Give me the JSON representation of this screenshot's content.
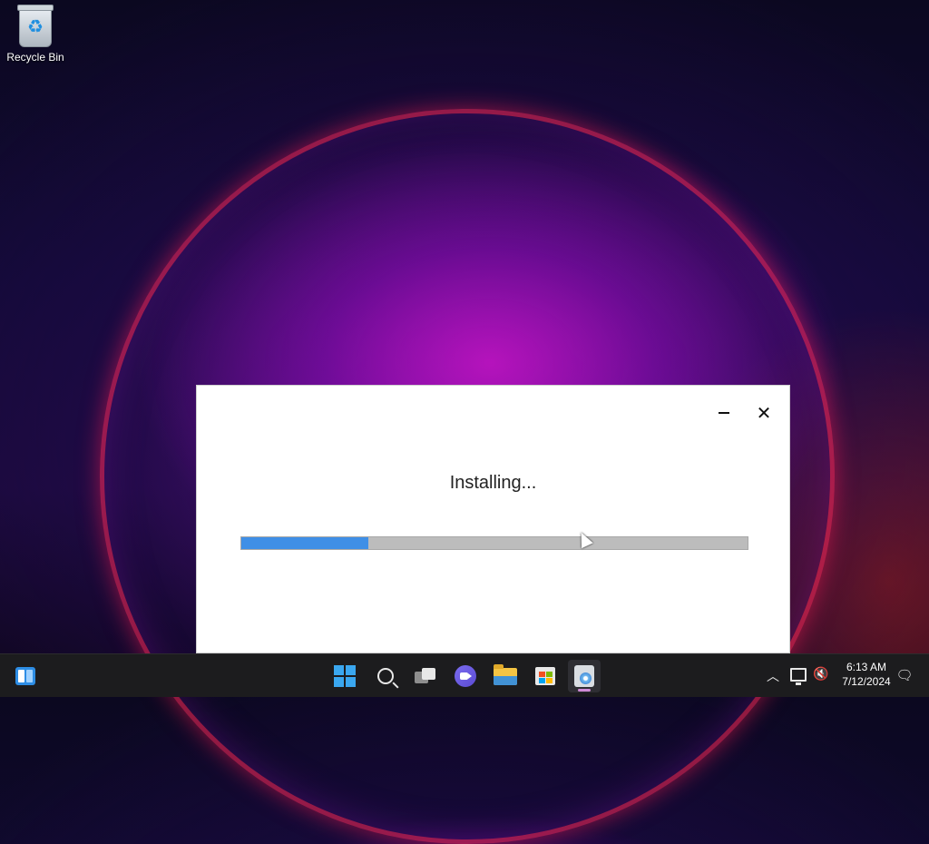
{
  "desktop": {
    "icons": [
      {
        "label": "Recycle Bin",
        "icon": "recycle-bin-icon"
      }
    ]
  },
  "installer": {
    "status_text": "Installing...",
    "progress": 0.25,
    "controls": {
      "minimize_icon": "minimize-icon",
      "close_icon": "close-icon"
    },
    "accent_color": "#3f8fe6"
  },
  "taskbar": {
    "items": [
      {
        "name": "widgets",
        "icon": "widgets-icon"
      },
      {
        "name": "start",
        "icon": "windows-logo-icon"
      },
      {
        "name": "search",
        "icon": "search-icon"
      },
      {
        "name": "task-view",
        "icon": "task-view-icon"
      },
      {
        "name": "chat",
        "icon": "chat-icon"
      },
      {
        "name": "file-explorer",
        "icon": "folder-icon"
      },
      {
        "name": "microsoft-store",
        "icon": "store-icon"
      },
      {
        "name": "installer",
        "icon": "installer-app-icon",
        "active": true
      }
    ],
    "tray": {
      "time": "6:13 AM",
      "date": "7/12/2024",
      "icons": [
        "chevron-up-icon",
        "network-icon",
        "volume-muted-icon",
        "notification-icon"
      ]
    }
  }
}
